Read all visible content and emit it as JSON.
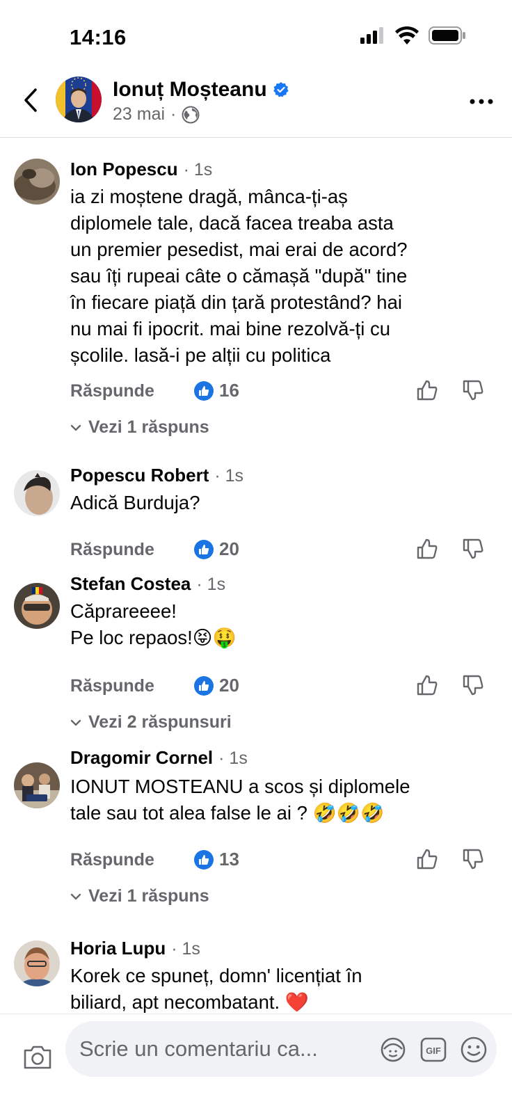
{
  "status_bar": {
    "time": "14:16"
  },
  "header": {
    "title": "Ionuț Moșteanu",
    "date": "23 mai",
    "separator": "·"
  },
  "comments": [
    {
      "author": "Ion Popescu",
      "time": "· 1s",
      "text": "ia zi moștene dragă, mânca-ți-aș\ndiplomele tale, dacă facea treaba asta\nun premier pesedist, mai erai de acord?\nsau îți rupeai câte o cămașă \"după\" tine\nîn fiecare piață din țară protestând? hai\nnu mai fi ipocrit. mai bine rezolvă-ți cu\nșcolile. lasă-i pe alții cu politica",
      "reply_label": "Răspunde",
      "likes": "16",
      "view_replies": "Vezi 1 răspuns"
    },
    {
      "author": "Popescu Robert",
      "time": "· 1s",
      "text": "Adică Burduja?",
      "reply_label": "Răspunde",
      "likes": "20"
    },
    {
      "author": "Stefan Costea",
      "time": "· 1s",
      "text": "Căprareeee!\nPe loc repaos!😝🤑",
      "reply_label": "Răspunde",
      "likes": "20",
      "view_replies": "Vezi 2 răspunsuri"
    },
    {
      "author": "Dragomir Cornel",
      "time": "· 1s",
      "text": "IONUT MOSTEANU  a scos și diplomele\ntale sau tot alea false le ai ? 🤣🤣🤣",
      "reply_label": "Răspunde",
      "likes": "13",
      "view_replies": "Vezi 1 răspuns"
    },
    {
      "author": "Horia Lupu",
      "time": "· 1s",
      "text": "Korek ce spuneț, domn' licențiat în\nbiliard, apt necombatant. ❤️"
    }
  ],
  "composer": {
    "placeholder": "Scrie un comentariu ca..."
  },
  "colors": {
    "accent": "#1b74e4",
    "verified": "#1877f2",
    "secondary_text": "#65676b",
    "input_bg": "#f0f2f5"
  },
  "icons": {
    "back": "chevron-left-icon",
    "verified": "verified-badge-icon",
    "privacy": "globe-icon",
    "more": "more-horizontal-icon",
    "like_badge": "like-badge-icon",
    "thumb_up": "thumb-up-icon",
    "thumb_down": "thumb-down-icon",
    "expand": "chevron-down-icon",
    "camera": "camera-icon",
    "avatar_sticker": "avatar-sticker-icon",
    "gif": "gif-icon",
    "emoji": "emoji-icon"
  }
}
